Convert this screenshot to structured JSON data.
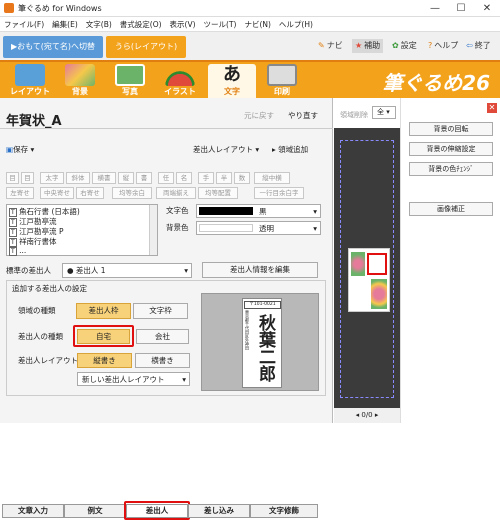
{
  "window": {
    "title": "筆ぐるめ for Windows",
    "min": "—",
    "max": "☐",
    "close": "✕"
  },
  "menu": [
    "ファイル(F)",
    "編集(E)",
    "文字(B)",
    "書式設定(O)",
    "表示(V)",
    "ツール(T)",
    "ナビ(N)",
    "ヘルプ(H)"
  ],
  "modes": {
    "omote": "おもて(宛て名)へ切替",
    "ura": "うら(レイアウト)"
  },
  "help_links": {
    "navi": "ナビ",
    "hojo": "補助",
    "settei": "設定",
    "help": "ヘルプ",
    "exit": "終了"
  },
  "tools": [
    {
      "label": "レイアウト",
      "color": "#5aa0d8"
    },
    {
      "label": "背景",
      "color": "#e57a9a"
    },
    {
      "label": "写真",
      "color": "#6cb36a"
    },
    {
      "label": "イラスト",
      "color": "#e04a3a"
    },
    {
      "label": "文字",
      "color": "#333333"
    },
    {
      "label": "印刷",
      "color": "#888888"
    }
  ],
  "brand": "筆ぐるめ26",
  "doc": {
    "title": "年賀状_A",
    "undo": "元に戻す",
    "redo": "やり直す",
    "save": "保存",
    "sender_layout": "差出人レイアウト",
    "add_area": "領域追加"
  },
  "format_row1": [
    "目",
    "目",
    "太字",
    "斜体",
    "横書",
    "縦",
    "書",
    "任",
    "名",
    "手",
    "半",
    "数",
    "縦中横"
  ],
  "format_row2": [
    "左寄せ",
    "中央寄せ",
    "右寄せ",
    "均等余白",
    "両端揃え",
    "均等配置",
    "一行目余白字"
  ],
  "fonts": [
    "魚石行書 (日本語)",
    "江戸勘亭流",
    "江戸勘亭流 P",
    "祥南行書体",
    "..."
  ],
  "color_labels": {
    "text": "文字色",
    "bg": "背景色",
    "text_value": "黒",
    "bg_value": "透明"
  },
  "sender": {
    "label": "標準の差出人",
    "value": "● 差出人 1",
    "edit": "差出人情報を編集"
  },
  "add_sender_section": "追加する差出人の設定",
  "area_type": {
    "label": "領域の種類",
    "opt1": "差出人枠",
    "opt2": "文字枠"
  },
  "sender_type": {
    "label": "差出人の種類",
    "opt1": "自宅",
    "opt2": "会社"
  },
  "sender_layout": {
    "label": "差出人レイアウト",
    "opt1": "縦書き",
    "opt2": "横書き",
    "select": "新しい差出人レイアウト"
  },
  "preview": {
    "postal": "〒101-0021",
    "address_line": "東京都千代田区外神田",
    "name": "秋葉二郎"
  },
  "tabs": [
    "文章入力",
    "例文",
    "差出人",
    "差し込み",
    "文字修飾"
  ],
  "center": {
    "area_delete": "領域削除",
    "page_select": "全",
    "page_counter": "0/0"
  },
  "right_buttons": [
    "背景の回転",
    "背景の伸縮設定",
    "背景の色ﾁｪﾝｼﾞ",
    "画像補正"
  ],
  "right_close": "✕"
}
